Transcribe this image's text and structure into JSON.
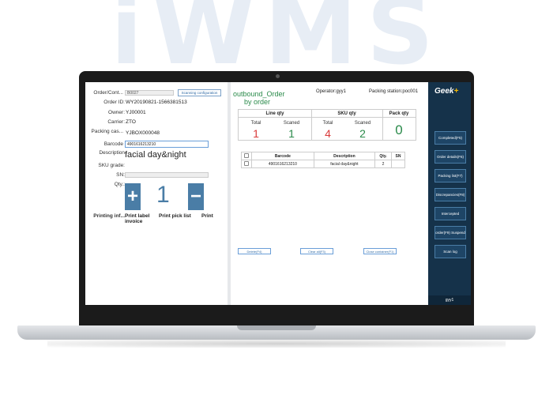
{
  "background_word": "iWMS",
  "left_panel": {
    "order_label": "Order/Cont...",
    "order_input": "B0027",
    "scanning_config_label": "Scanning configuration",
    "order_id_label": "Order ID:",
    "order_id_value": "WY20190821-1566381513",
    "owner_label": "Owner:",
    "owner_value": "YJ00001",
    "carrier_label": "Carrier:",
    "carrier_value": "ZTO",
    "packing_cas_label": "Packing cas...",
    "packing_cas_value": "YJBOX000048",
    "barcode_label": "Barcode",
    "barcode_value": "4901616213210",
    "description_label": "Description",
    "description_value": "facial day&night",
    "sku_grade_label": "SKU grade:",
    "sn_label": "SN:",
    "qty_label": "Qty.:",
    "qty_plus": "+",
    "qty_value": "1",
    "qty_minus": "−",
    "printing_label": "Printing inf...",
    "print_label_invoice_a": "Print label",
    "print_label_invoice_b": "invoice",
    "print_pick_list": "Print pick list",
    "print": "Print"
  },
  "center_panel": {
    "title_line1": "outbound_Order",
    "title_line2": "by order",
    "operator": "Operator:gyy1",
    "packing_station": "Packing station:poc001",
    "stats": {
      "line_qty_header": "Line qty",
      "sku_qty_header": "SKU qty",
      "pack_qty_header": "Pack qty",
      "total_label": "Total",
      "scaned_label": "Scaned",
      "line_total": "1",
      "line_scaned": "1",
      "sku_total": "4",
      "sku_scaned": "2",
      "pack_qty": "0"
    },
    "table": {
      "headers": [
        "Barcode",
        "Description",
        "Qty.",
        "SN"
      ],
      "rows": [
        {
          "barcode": "4901616213210",
          "description": "facial day&night",
          "qty": "2",
          "sn": ""
        }
      ]
    },
    "buttons": {
      "delete": "Delete(F4)",
      "clear_all": "Clear all(F3)",
      "close_container": "Close container(F1)"
    }
  },
  "sidebar": {
    "logo": "Geek",
    "logo_plus": "+",
    "items": [
      "Completed(F5)",
      "Order details(F6)",
      "Packing list(F7)",
      "Discrepancies(F8)",
      "Intercepted",
      "order(F9) Suspend",
      "Scan log"
    ],
    "user": "gyy1"
  },
  "colors": {
    "accent_blue": "#4a7da6",
    "sidebar_bg": "#15324a",
    "green": "#2a8a4a",
    "red": "#d93a3a",
    "logo_plus": "#f5b800"
  }
}
